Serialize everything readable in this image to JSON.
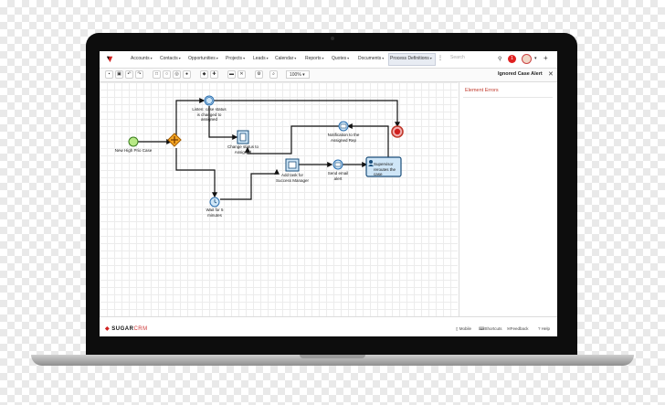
{
  "nav": {
    "items": [
      "Accounts",
      "Contacts",
      "Opportunities",
      "Projects",
      "Leads",
      "Calendar",
      "Reports",
      "Quotes",
      "Documents",
      "Process Definitions"
    ],
    "more_icon": "vertical-ellipsis-icon",
    "search_placeholder": "Search",
    "notification_count": "1"
  },
  "toolbar": {
    "zoom": "100%",
    "record_title": "Ignored Case Alert"
  },
  "panel": {
    "errors_title": "Element Errors"
  },
  "diagram": {
    "start_label": "New High Prio Case",
    "listen_label": "Listen: case status is changed to assigned",
    "change_status_label": "Change status to Assigned",
    "wait_label": "Wait for 5 minutes",
    "add_task_label": "Add task for Success Manager",
    "send_email_label": "Send email alert",
    "notification_label": "Notification to the Assigned Rep",
    "supervisor_label": "Supervisor reroutes the case"
  },
  "footer": {
    "brand_bold": "SUGAR",
    "brand_light": "CRM",
    "mobile": "Mobile",
    "shortcuts": "Shortcuts",
    "feedback": "Feedback",
    "help": "Help"
  },
  "colors": {
    "accent_red": "#e02020",
    "task_blue": "#cfe6f7",
    "gateway_orange": "#f5a623"
  }
}
